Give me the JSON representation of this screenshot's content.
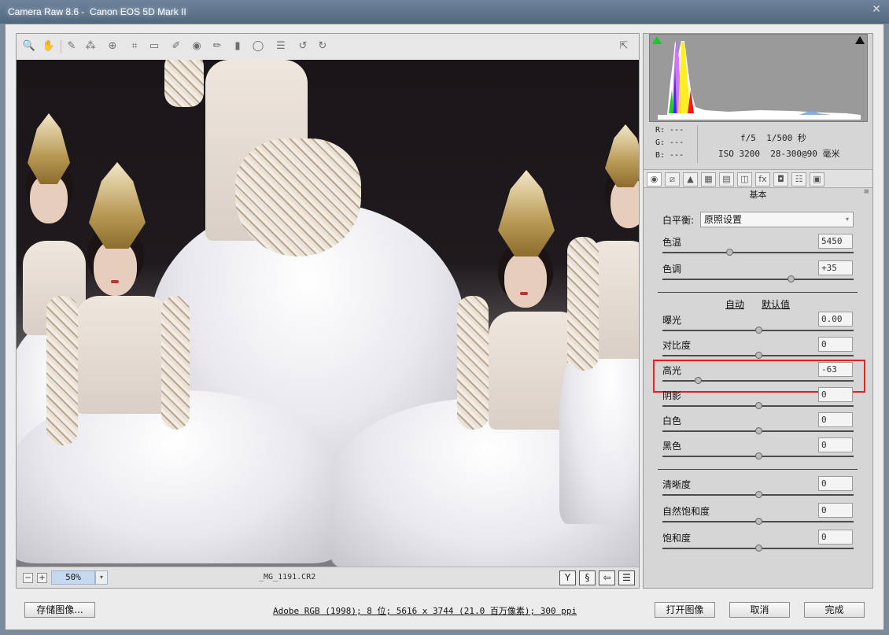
{
  "window": {
    "title": "Camera Raw 8.6 -  Canon EOS 5D Mark II",
    "close_glyph": "✕"
  },
  "toolbar": {
    "tools": [
      {
        "name": "zoom-tool",
        "glyph": "🔍"
      },
      {
        "name": "hand-tool",
        "glyph": "✋"
      },
      {
        "name": "white-balance-tool",
        "glyph": "✎"
      },
      {
        "name": "color-sampler-tool",
        "glyph": "⁂"
      },
      {
        "name": "targeted-adjustment-tool",
        "glyph": "⊕"
      },
      {
        "name": "crop-tool",
        "glyph": "⌗"
      },
      {
        "name": "straighten-tool",
        "glyph": "▭"
      },
      {
        "name": "spot-removal-tool",
        "glyph": "✐"
      },
      {
        "name": "red-eye-tool",
        "glyph": "◉"
      },
      {
        "name": "adjustment-brush-tool",
        "glyph": "✏"
      },
      {
        "name": "graduated-filter-tool",
        "glyph": "▮"
      },
      {
        "name": "radial-filter-tool",
        "glyph": "◯"
      },
      {
        "name": "preferences-tool",
        "glyph": "☰"
      },
      {
        "name": "rotate-ccw-tool",
        "glyph": "↺"
      },
      {
        "name": "rotate-cw-tool",
        "glyph": "↻"
      }
    ],
    "fullscreen_glyph": "⇱"
  },
  "preview": {
    "zoom_out": "−",
    "zoom_in": "+",
    "zoom_level": "50%",
    "zoom_dropdown_glyph": "▾",
    "filename": "_MG_1191.CR2",
    "view_buttons": [
      "Y",
      "§",
      "⇦",
      "☰"
    ]
  },
  "histogram": {
    "rgb": {
      "r": "R:  ---",
      "g": "G:  ---",
      "b": "B:  ---"
    },
    "exif": {
      "line1": "f/5  1/500 秒",
      "line2": "ISO 3200  28-300@90 毫米"
    }
  },
  "panel": {
    "tabs": [
      "◉",
      "⧄",
      "▲",
      "▦",
      "▤",
      "◫",
      "fx",
      "◘",
      "☷",
      "▣"
    ],
    "section_title": "基本",
    "menu_glyph": "≡",
    "white_balance": {
      "label": "白平衡:",
      "value": "原照设置",
      "arrow": "▾"
    },
    "temp": {
      "label": "色温",
      "value": "5450",
      "position": 0.35
    },
    "tint": {
      "label": "色调",
      "value": "+35",
      "position": 0.67
    },
    "auto_label": "自动",
    "default_label": "默认值",
    "exposure": {
      "label": "曝光",
      "value": "0.00",
      "position": 0.5
    },
    "contrast": {
      "label": "对比度",
      "value": "0",
      "position": 0.5
    },
    "highlights": {
      "label": "高光",
      "value": "-63",
      "position": 0.185
    },
    "shadows": {
      "label": "阴影",
      "value": "0",
      "position": 0.5
    },
    "whites": {
      "label": "白色",
      "value": "0",
      "position": 0.5
    },
    "blacks": {
      "label": "黑色",
      "value": "0",
      "position": 0.5
    },
    "clarity": {
      "label": "清晰度",
      "value": "0",
      "position": 0.5
    },
    "vibrance": {
      "label": "自然饱和度",
      "value": "0",
      "position": 0.5
    },
    "saturation": {
      "label": "饱和度",
      "value": "0",
      "position": 0.5
    }
  },
  "footer": {
    "save_label": "存储图像...",
    "file_info": "Adobe RGB (1998); 8 位; 5616 x 3744 (21.0 百万像素); 300 ppi",
    "open_label": "打开图像",
    "cancel_label": "取消",
    "done_label": "完成"
  },
  "colors": {
    "accent_highlight": "#e41f1f",
    "zoom_field": "#c6d8ee"
  }
}
